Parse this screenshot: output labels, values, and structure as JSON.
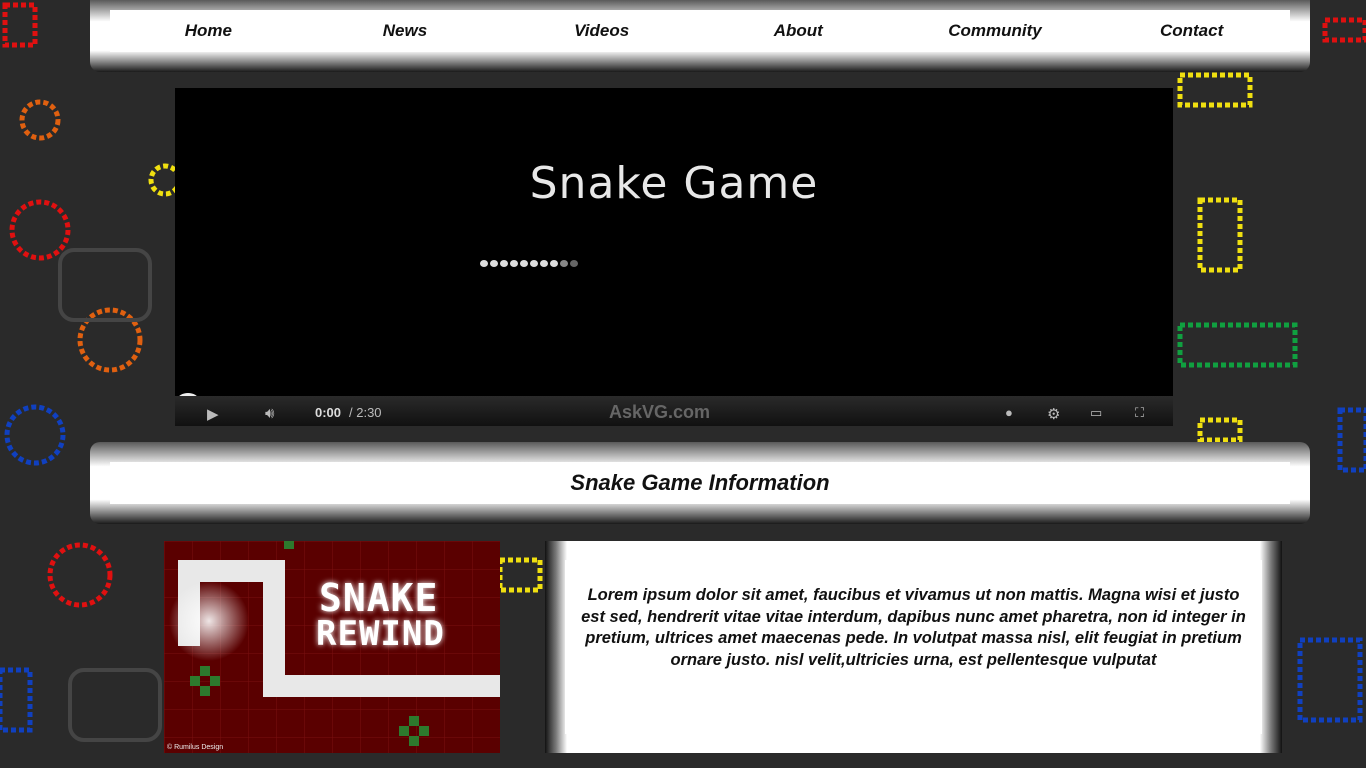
{
  "nav": {
    "items": [
      "Home",
      "News",
      "Videos",
      "About",
      "Community",
      "Contact"
    ]
  },
  "video": {
    "title": "Snake Game",
    "time_current": "0:00",
    "time_total": "/ 2:30",
    "watermark": "AskVG.com",
    "progress": 0
  },
  "section": {
    "title": "Snake Game Information"
  },
  "game_image": {
    "line1": "SNAKE",
    "line2": "REWIND",
    "credit": "© Rumilus Design"
  },
  "description": "Lorem ipsum dolor sit amet, faucibus et vivamus ut non mattis. Magna wisi et justo est sed, hendrerit vitae vitae interdum, dapibus nunc amet pharetra, non id integer in pretium, ultrices amet maecenas pede. In volutpat massa nisl, elit feugiat in pretium ornare justo.  nisl velit,ultricies urna, est pellentesque vulputat",
  "colors": {
    "background": "#2a2a2a",
    "video_bg": "#000000",
    "game_bg": "#5a0000"
  }
}
